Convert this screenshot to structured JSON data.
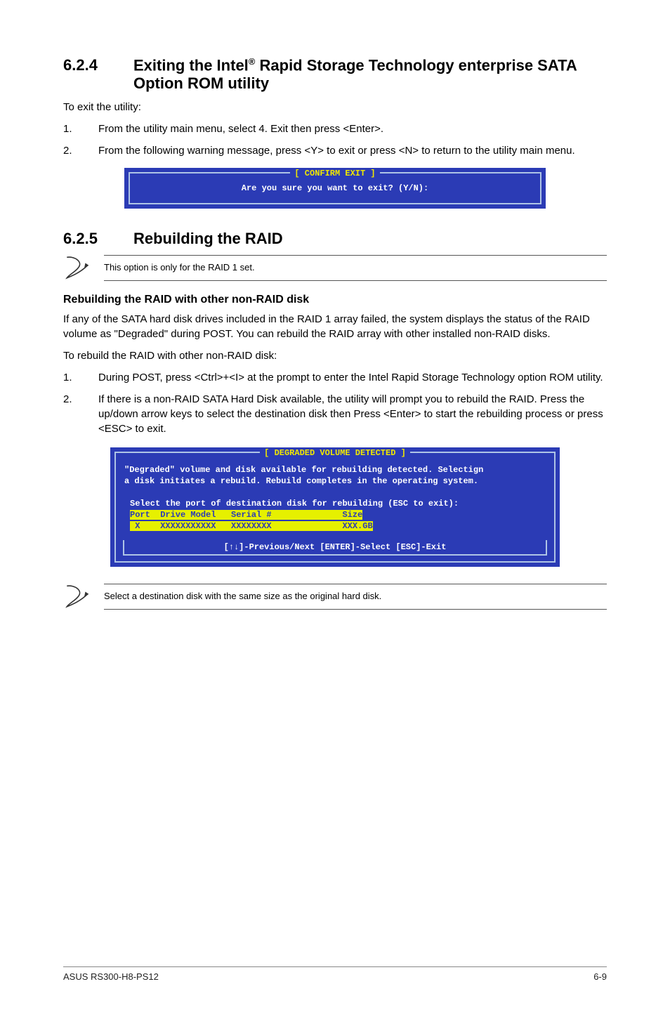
{
  "sec624": {
    "num": "6.2.4",
    "title_a": "Exiting the Intel",
    "title_sup": "®",
    "title_b": " Rapid Storage Technology enterprise SATA Option ROM utility",
    "intro": "To exit the utility:",
    "steps": [
      {
        "n": "1.",
        "t": "From the utility main menu, select 4. Exit then press <Enter>."
      },
      {
        "n": "2.",
        "t": "From the following warning message, press <Y> to exit or press <N> to return to the utility main menu."
      }
    ],
    "box": {
      "title": "[ CONFIRM EXIT ]",
      "body": "Are you sure you want to exit? (Y/N):"
    }
  },
  "sec625": {
    "num": "6.2.5",
    "title": "Rebuilding the RAID",
    "note1": "This option is only for the RAID 1 set.",
    "subheading": "Rebuilding the RAID with other non-RAID disk",
    "para1": "If any of the SATA hard disk drives included in the RAID 1 array failed, the system displays the status of the RAID volume as \"Degraded\" during POST. You can rebuild the RAID array with other installed non-RAID disks.",
    "para2": "To rebuild the RAID with other non-RAID disk:",
    "steps": [
      {
        "n": "1.",
        "t": "During POST, press <Ctrl>+<I> at the prompt to enter the Intel Rapid Storage Technology option ROM utility."
      },
      {
        "n": "2.",
        "t": "If there is a non-RAID SATA Hard Disk available, the utility will prompt you to rebuild the RAID. Press the up/down arrow keys to select  the destination disk then Press <Enter> to start the rebuilding process or press <ESC> to exit."
      }
    ],
    "bigbox": {
      "title": "[ DEGRADED VOLUME DETECTED ]",
      "msg": "\"Degraded\" volume and disk available for rebuilding detected. Selectign\na disk initiates a rebuild. Rebuild completes in the operating system.",
      "inner_line": "Select the port of destination disk for rebuilding (ESC to exit):",
      "inner_hdr": "Port  Drive Model   Serial #              Size",
      "inner_row": " X    XXXXXXXXXXX   XXXXXXXX              XXX.GB",
      "footer": "[↑↓]-Previous/Next [ENTER]-Select [ESC]-Exit"
    },
    "note2": "Select a destination disk with the same size as the original hard disk."
  },
  "footer": {
    "left": "ASUS RS300-H8-PS12",
    "right": "6-9"
  }
}
